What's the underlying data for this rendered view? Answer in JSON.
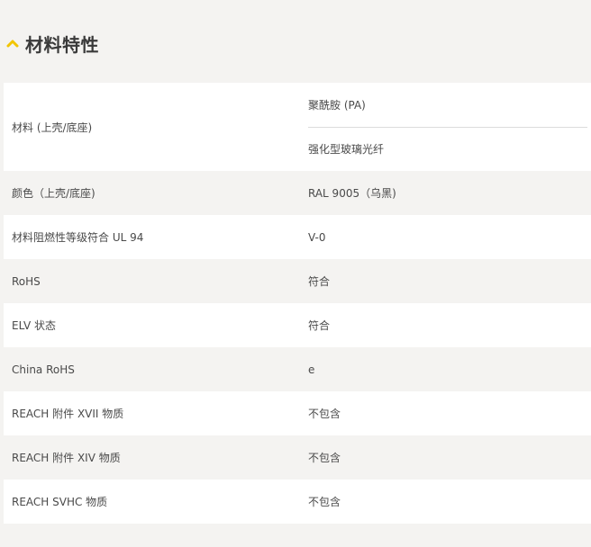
{
  "section": {
    "title": "材料特性",
    "toggle_icon": "chevron-up-icon",
    "accent_color": "#f2c500"
  },
  "rows": [
    {
      "label": "材料 (上壳/底座)",
      "values": [
        "聚酰胺 (PA)",
        "强化型玻璃光纤"
      ]
    },
    {
      "label": "颜色（上壳/底座)",
      "value": "RAL 9005（乌黑)"
    },
    {
      "label": "材料阻燃性等级符合 UL 94",
      "value": "V-0"
    },
    {
      "label": "RoHS",
      "value": "符合"
    },
    {
      "label": "ELV 状态",
      "value": "符合"
    },
    {
      "label": "China RoHS",
      "value": "e"
    },
    {
      "label": "REACH 附件 XVII 物质",
      "value": "不包含"
    },
    {
      "label": "REACH 附件 XIV 物质",
      "value": "不包含"
    },
    {
      "label": "REACH SVHC 物质",
      "value": "不包含"
    }
  ]
}
